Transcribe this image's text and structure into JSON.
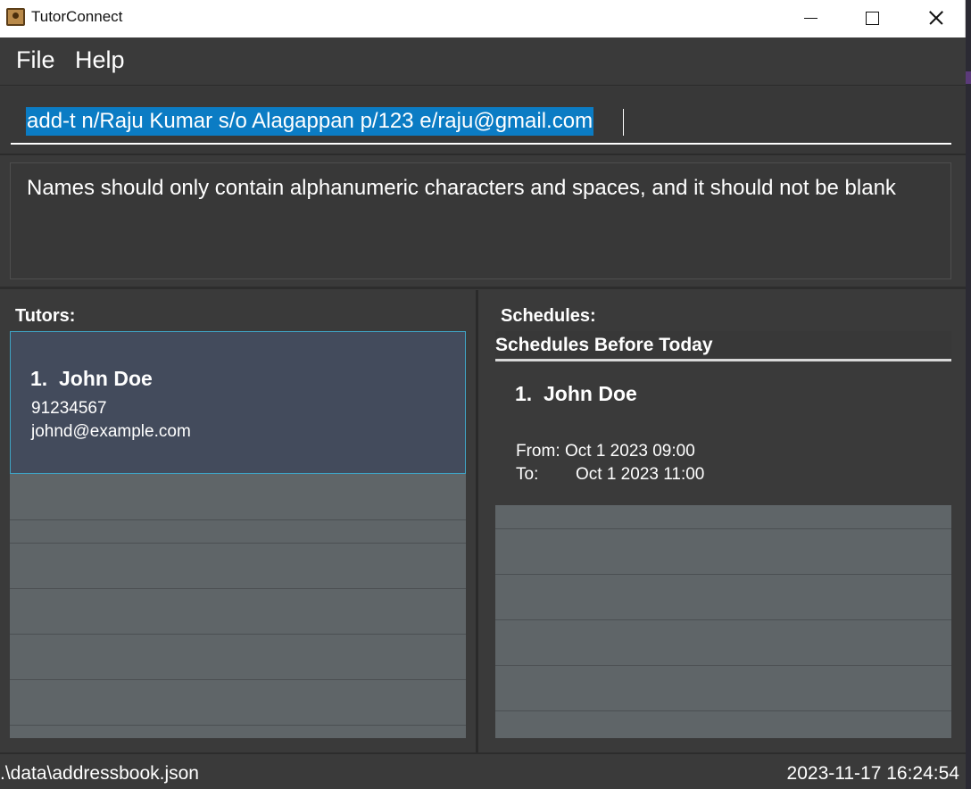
{
  "window": {
    "title": "TutorConnect",
    "icon": "address-book-icon"
  },
  "menu": {
    "items": [
      {
        "label": "File"
      },
      {
        "label": "Help"
      }
    ]
  },
  "command_box": {
    "value": "add-t n/Raju Kumar s/o Alagappan p/123 e/raju@gmail.com"
  },
  "result_display": {
    "text": "Names should only contain alphanumeric characters and spaces, and it should not be blank"
  },
  "tutors": {
    "label": "Tutors:",
    "items": [
      {
        "index": "1.",
        "name": "John Doe",
        "phone": "91234567",
        "email": "johnd@example.com"
      }
    ]
  },
  "schedules": {
    "label": "Schedules:",
    "group_header": "Schedules Before Today",
    "items": [
      {
        "index": "1.",
        "name": "John Doe",
        "from_label": "From:",
        "from": "Oct 1 2023 09:00",
        "to_label": "To:",
        "to": "Oct 1 2023 11:00"
      }
    ]
  },
  "status_bar": {
    "path": ".\\data\\addressbook.json",
    "timestamp": "2023-11-17 16:24:54"
  },
  "colors": {
    "app_background": "#3a3a3a",
    "selection_highlight": "#0b7cc4",
    "selected_card": "#434b5c",
    "selected_card_border": "#3fa3c4",
    "list_background": "#5f6568"
  }
}
